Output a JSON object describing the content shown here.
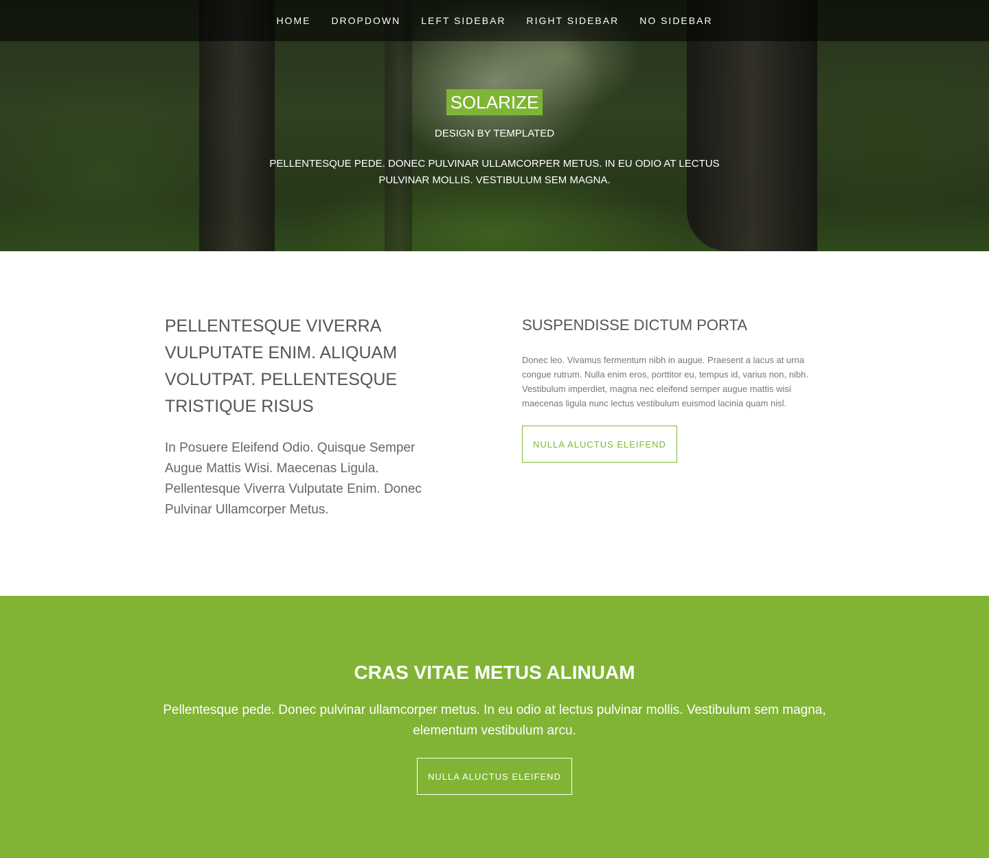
{
  "nav": {
    "items": [
      {
        "label": "HOME"
      },
      {
        "label": "DROPDOWN"
      },
      {
        "label": "LEFT SIDEBAR"
      },
      {
        "label": "RIGHT SIDEBAR"
      },
      {
        "label": "NO SIDEBAR"
      }
    ]
  },
  "hero": {
    "logo": "SOLARIZE",
    "byline": "DESIGN BY TEMPLATED",
    "text": "PELLENTESQUE PEDE. DONEC PULVINAR ULLAMCORPER METUS. IN EU ODIO AT LECTUS PULVINAR MOLLIS. VESTIBULUM SEM MAGNA."
  },
  "main": {
    "left": {
      "title": "PELLENTESQUE VIVERRA VULPUTATE ENIM. ALIQUAM VOLUTPAT. PELLENTESQUE TRISTIQUE RISUS",
      "lead": "In Posuere Eleifend Odio. Quisque Semper Augue Mattis Wisi. Maecenas Ligula. Pellentesque Viverra Vulputate Enim. Donec Pulvinar Ullamcorper Metus."
    },
    "right": {
      "title": "SUSPENDISSE DICTUM PORTA",
      "body": "Donec leo. Vivamus fermentum nibh in augue. Praesent a lacus at urna congue rutrum. Nulla enim eros, porttitor eu, tempus id, varius non, nibh. Vestibulum imperdiet, magna nec eleifend semper augue mattis wisi maecenas ligula nunc lectus vestibulum euismod lacinia quam nisl.",
      "button": "NULLA ALUCTUS ELEIFEND"
    }
  },
  "band": {
    "title": "CRAS VITAE METUS ALINUAM",
    "text": "Pellentesque pede. Donec pulvinar ullamcorper metus. In eu odio at lectus pulvinar mollis. Vestibulum sem magna, elementum vestibulum arcu.",
    "button": "NULLA ALUCTUS ELEIFEND"
  },
  "colors": {
    "accent": "#7fb536",
    "band": "#81b435",
    "nav_bg": "rgba(0,0,0,0.55)"
  }
}
